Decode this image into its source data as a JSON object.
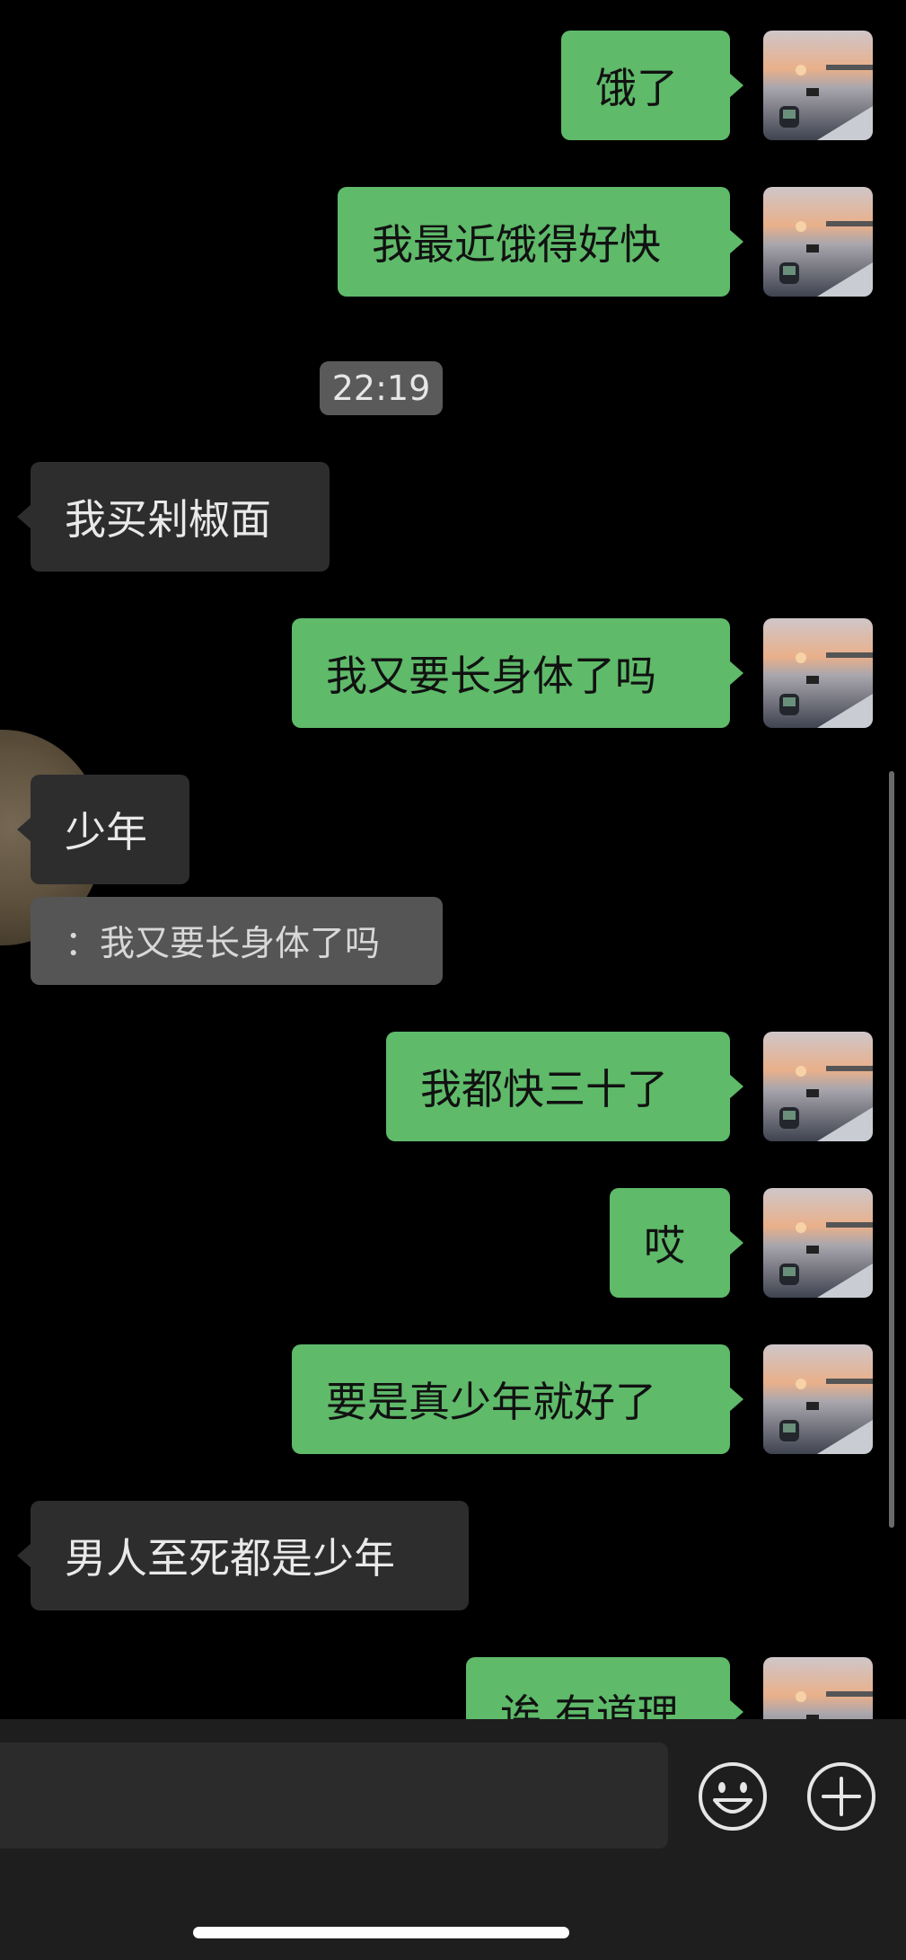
{
  "chat": {
    "messages": [
      {
        "side": "sent",
        "text": "饿了"
      },
      {
        "side": "sent",
        "text": "我最近饿得好快"
      },
      {
        "side": "recv",
        "text": "我买剁椒面"
      },
      {
        "side": "sent",
        "text": "我又要长身体了吗"
      },
      {
        "side": "recv",
        "text": "少年"
      },
      {
        "side": "sent",
        "text": "我都快三十了"
      },
      {
        "side": "sent",
        "text": "哎"
      },
      {
        "side": "sent",
        "text": "要是真少年就好了"
      },
      {
        "side": "recv",
        "text": "男人至死都是少年"
      },
      {
        "side": "sent",
        "text": "诶 有道理"
      }
    ],
    "timestamp": "22:19",
    "quote": {
      "text": "：我又要长身体了吗"
    }
  },
  "input_bar": {
    "placeholder": "",
    "emoji_icon": "emoji-smile-icon",
    "more_icon": "plus-circle-icon"
  },
  "colors": {
    "background": "#000000",
    "sent_bubble": "#5fba6a",
    "received_bubble": "#2d2d2d",
    "input_bar": "#1e1e1e"
  }
}
